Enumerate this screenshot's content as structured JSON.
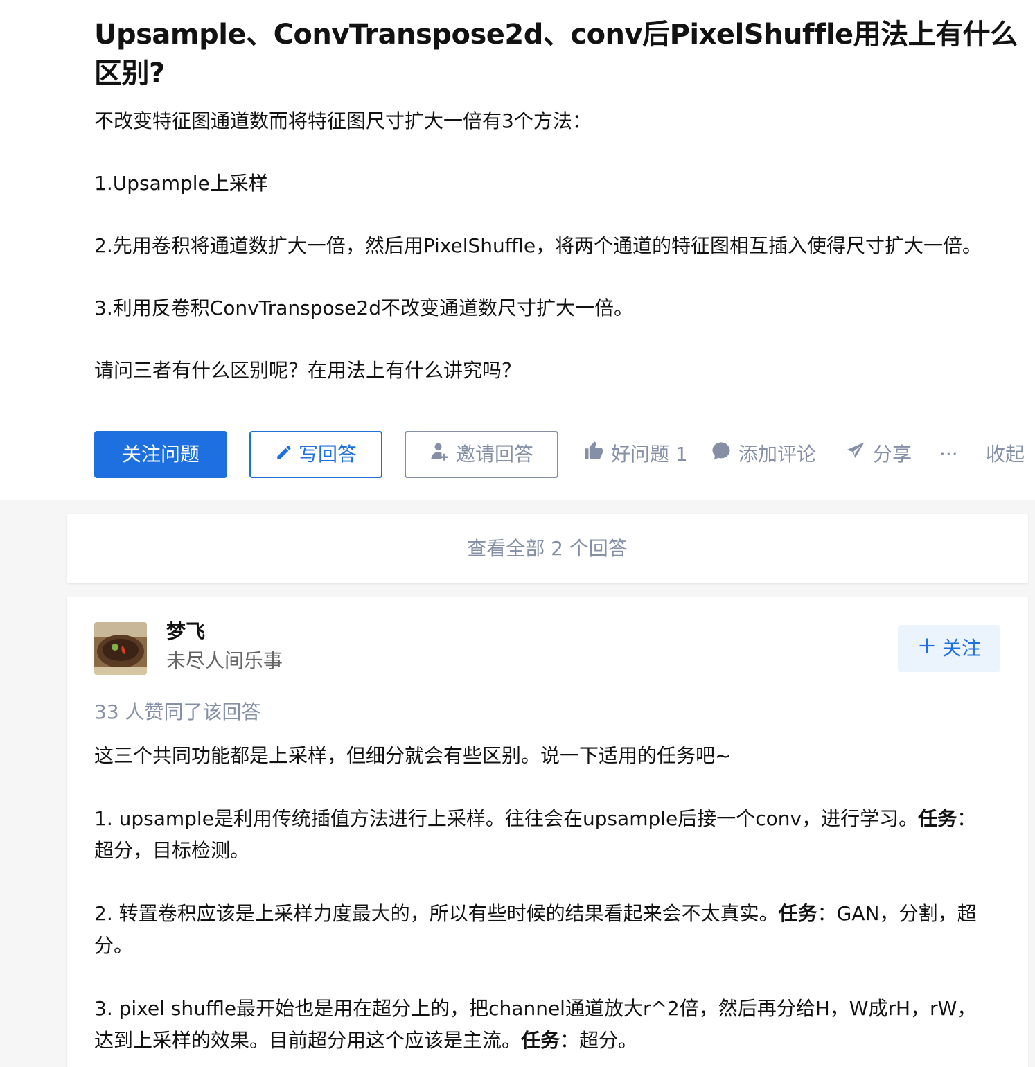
{
  "question": {
    "title": "Upsample、ConvTranspose2d、conv后PixelShuffle用法上有什么区别?",
    "body": [
      "不改变特征图通道数而将特征图尺寸扩大一倍有3个方法：",
      "1.Upsample上采样",
      "2.先用卷积将通道数扩大一倍，然后用PixelShuffle，将两个通道的特征图相互插入使得尺寸扩大一倍。",
      "3.利用反卷积ConvTranspose2d不改变通道数尺寸扩大一倍。",
      "请问三者有什么区别呢？在用法上有什么讲究吗？"
    ],
    "actions": {
      "follow": "关注问题",
      "write": "写回答",
      "invite": "邀请回答",
      "good_question": "好问题 1",
      "comment": "添加评论",
      "share": "分享",
      "more": "···",
      "collapse": "收起"
    }
  },
  "view_all": "查看全部 2 个回答",
  "answer": {
    "author_name": "梦飞",
    "author_bio": "未尽人间乐事",
    "follow_label": "关注",
    "upvotes": "33 人赞同了该回答",
    "intro": "这三个共同功能都是上采样，但细分就会有些区别。说一下适用的任务吧~",
    "items": [
      {
        "text": "1. upsample是利用传统插值方法进行上采样。往往会在upsample后接一个conv，进行学习。",
        "task_label": "任务",
        "task_text": "：超分，目标检测。"
      },
      {
        "text": "2. 转置卷积应该是上采样力度最大的，所以有些时候的结果看起来会不太真实。",
        "task_label": "任务",
        "task_text": "：GAN，分割，超分。"
      },
      {
        "text": "3. pixel shuffle最开始也是用在超分上的，把channel通道放大r^2倍，然后再分给H，W成rH，rW，达到上采样的效果。目前超分用这个应该是主流。",
        "task_label": "任务",
        "task_text": "：超分。"
      }
    ]
  },
  "colors": {
    "accent": "#1e6fdf",
    "muted": "#8590a6",
    "text": "#121212",
    "background": "#f6f6f6"
  },
  "icons": [
    "pencil-icon",
    "invite-user-icon",
    "thumbs-up-icon",
    "comment-icon",
    "share-plane-icon",
    "plus-icon"
  ]
}
